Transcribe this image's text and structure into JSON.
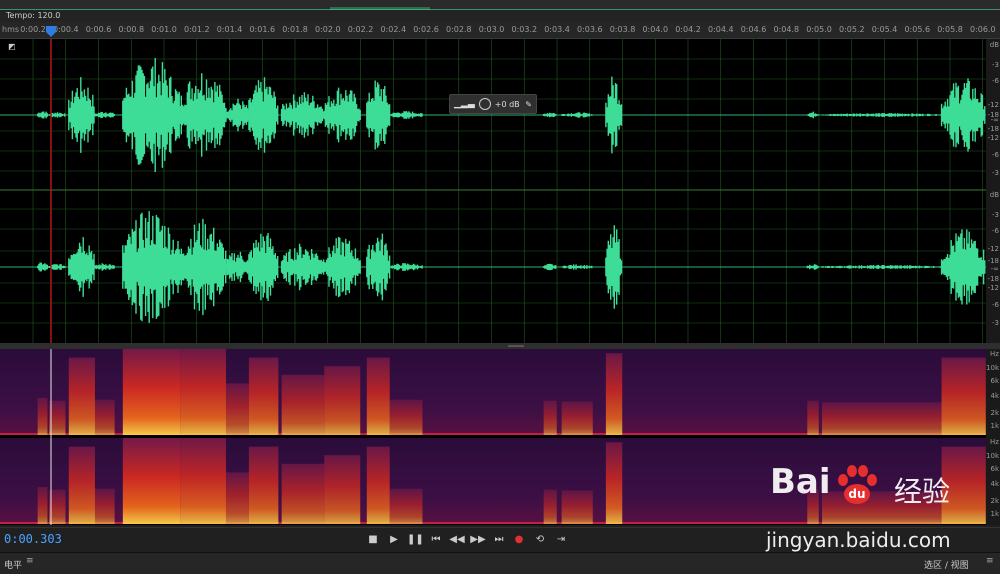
{
  "tempo_label": "Tempo: 120.0",
  "ruler": {
    "unit_label": "hms",
    "ticks": [
      "0:00.2",
      "0:00.4",
      "0:00.6",
      "0:00.8",
      "0:01.0",
      "0:01.2",
      "0:01.4",
      "0:01.6",
      "0:01.8",
      "0:02.0",
      "0:02.2",
      "0:02.4",
      "0:02.6",
      "0:02.8",
      "0:03.0",
      "0:03.2",
      "0:03.4",
      "0:03.6",
      "0:03.8",
      "0:04.0",
      "0:04.2",
      "0:04.4",
      "0:04.6",
      "0:04.8",
      "0:05.0",
      "0:05.2",
      "0:05.4",
      "0:05.6",
      "0:05.8",
      "0:06.0"
    ]
  },
  "gain_hud": {
    "value": "+0 dB"
  },
  "db_scale": {
    "channel1": [
      "dB",
      "-3",
      "-6",
      "-12",
      "-18",
      "-∞",
      "-18",
      "-12",
      "-6",
      "-3"
    ],
    "channel2": [
      "dB",
      "-3",
      "-6",
      "-12",
      "-18",
      "-∞",
      "-18",
      "-12",
      "-6",
      "-3"
    ]
  },
  "hz_scale": {
    "channel1": [
      "Hz",
      "10k",
      "6k",
      "4k",
      "2k",
      "1k"
    ],
    "channel2": [
      "Hz",
      "10k",
      "6k",
      "4k",
      "2k",
      "1k"
    ]
  },
  "transport": {
    "timecode": "0:00.303",
    "buttons": [
      "stop",
      "play",
      "pause",
      "go-to-start",
      "rewind",
      "fast-forward",
      "go-to-end",
      "record",
      "loop",
      "skip-selection"
    ]
  },
  "status": {
    "left_label": "电平",
    "right_label": "选区 / 视图",
    "menu_glyph": "≡"
  },
  "watermark": {
    "brand": "Bai",
    "brand2": "du",
    "cn": "经验",
    "url": "jingyan.baidu.com"
  },
  "colors": {
    "waveform": "#3ddc97",
    "playhead": "#b01818",
    "timecode": "#4aa3ff",
    "grid": "#1f5a1f"
  },
  "waveform_segments": [
    {
      "start": 0.23,
      "end": 0.29,
      "amp": 0.08
    },
    {
      "start": 0.3,
      "end": 0.4,
      "amp": 0.05
    },
    {
      "start": 0.42,
      "end": 0.58,
      "amp": 0.55
    },
    {
      "start": 0.58,
      "end": 0.7,
      "amp": 0.06
    },
    {
      "start": 0.75,
      "end": 1.1,
      "amp": 0.85
    },
    {
      "start": 1.1,
      "end": 1.38,
      "amp": 0.7
    },
    {
      "start": 1.38,
      "end": 1.52,
      "amp": 0.25
    },
    {
      "start": 1.52,
      "end": 1.7,
      "amp": 0.55
    },
    {
      "start": 1.72,
      "end": 1.98,
      "amp": 0.35
    },
    {
      "start": 1.98,
      "end": 2.2,
      "amp": 0.45
    },
    {
      "start": 2.24,
      "end": 2.38,
      "amp": 0.55
    },
    {
      "start": 2.38,
      "end": 2.58,
      "amp": 0.06
    },
    {
      "start": 3.32,
      "end": 3.4,
      "amp": 0.05
    },
    {
      "start": 3.43,
      "end": 3.62,
      "amp": 0.04
    },
    {
      "start": 3.7,
      "end": 3.8,
      "amp": 0.6
    }
  ]
}
